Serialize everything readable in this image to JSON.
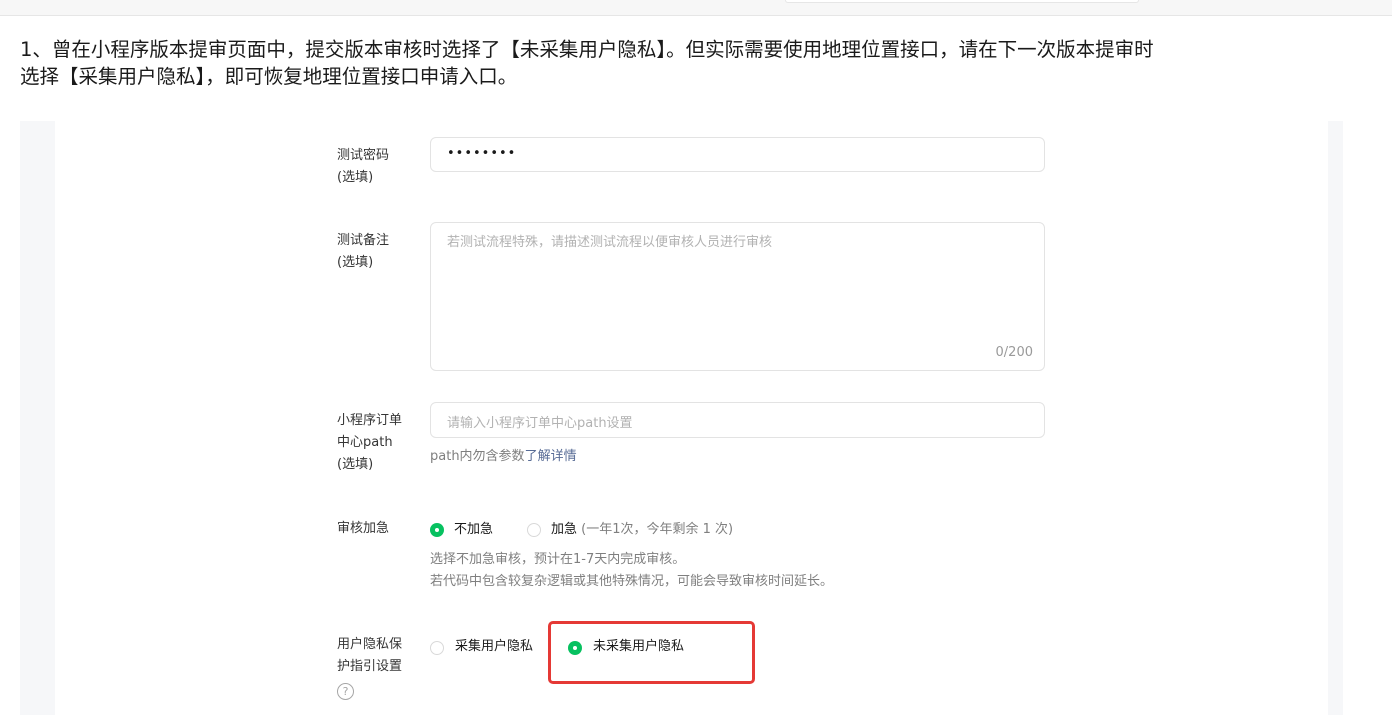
{
  "notice": {
    "line1": "1、曾在小程序版本提审页面中，提交版本审核时选择了【未采集用户隐私】。但实际需要使用地理位置接口，请在下一次版本提审时",
    "line2": "选择【采集用户隐私】，即可恢复地理位置接口申请入口。"
  },
  "form": {
    "test_password": {
      "label_line1": "测试密码",
      "label_line2": "(选填)",
      "value": "••••••••"
    },
    "test_notes": {
      "label_line1": "测试备注",
      "label_line2": "(选填)",
      "placeholder": "若测试流程特殊，请描述测试流程以便审核人员进行审核",
      "counter": "0/200"
    },
    "order_path": {
      "label_line1": "小程序订单",
      "label_line2": "中心path",
      "label_line3": "(选填)",
      "placeholder": "请输入小程序订单中心path设置",
      "hint_prefix": "path内勿含参数",
      "hint_link": "了解详情"
    },
    "urgent_review": {
      "label": "审核加急",
      "option_not_urgent": "不加急",
      "option_urgent": "加急",
      "urgent_note": "(一年1次，今年剩余  1  次)",
      "selected": "不加急",
      "hint_line1": "选择不加急审核，预计在1-7天内完成审核。",
      "hint_line2": "若代码中包含较复杂逻辑或其他特殊情况，可能会导致审核时间延长。"
    },
    "privacy": {
      "label_line1": "用户隐私保",
      "label_line2": "护指引设置",
      "help_icon": "question-circle-icon",
      "help_glyph": "?",
      "option_collect": "采集用户隐私",
      "option_not_collect": "未采集用户隐私",
      "selected": "未采集用户隐私"
    }
  },
  "colors": {
    "accent": "#07c160",
    "highlight": "#e53935",
    "link": "#576b95"
  }
}
